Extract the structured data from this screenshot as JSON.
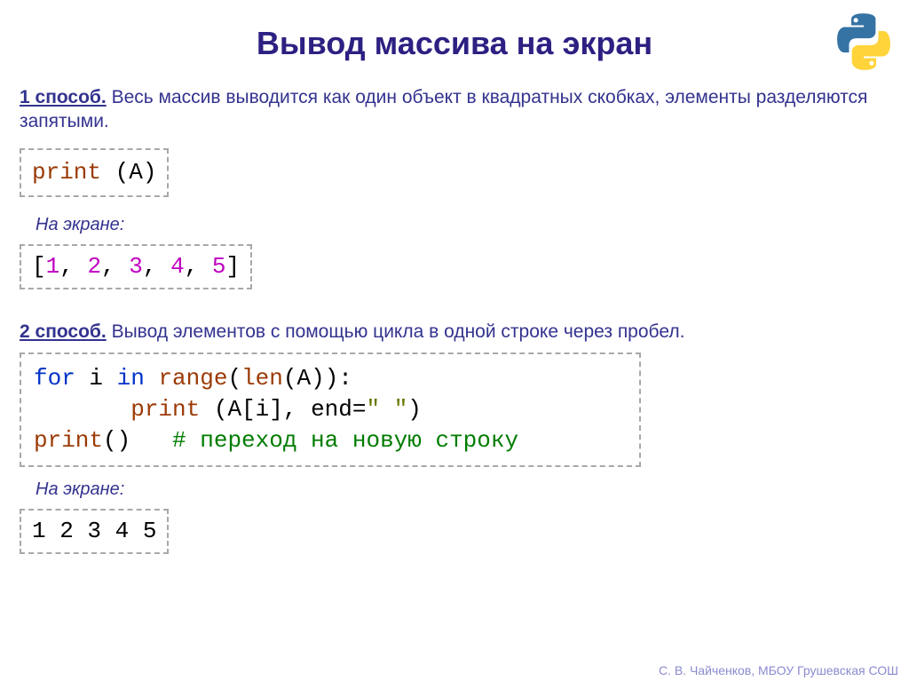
{
  "title": "Вывод массива на экран",
  "method1": {
    "label": "1 способ.",
    "text": " Весь массив выводится как один объект в квадратных скобках, элементы разделяются запятыми."
  },
  "code1": {
    "fn": "print",
    "paren_open": " (",
    "arg": "A",
    "paren_close": ")"
  },
  "screen_label": "На экране:",
  "output1": {
    "b1": "[",
    "v1": "1",
    "c": ", ",
    "v2": "2",
    "v3": "3",
    "v4": "4",
    "v5": "5",
    "b2": "]"
  },
  "method2": {
    "label": "2 способ.",
    "text": " Вывод элементов с помощью цикла в одной строке через пробел."
  },
  "code2": {
    "l1_for": "for",
    "l1_i": " i ",
    "l1_in": "in",
    "l1_sp": " ",
    "l1_range": "range",
    "l1_open": "(",
    "l1_len": "len",
    "l1_arg": "(A)):",
    "l2_indent": "       ",
    "l2_print": "print",
    "l2_open": " (",
    "l2_arg": "A[i], end=",
    "l2_str": "\" \"",
    "l2_close": ")",
    "l3_print": "print",
    "l3_call": "()   ",
    "l3_comment": "# переход на новую строку"
  },
  "output2": "1 2 3 4 5",
  "footer": "С. В. Чайченков, МБОУ Грушевская СОШ"
}
